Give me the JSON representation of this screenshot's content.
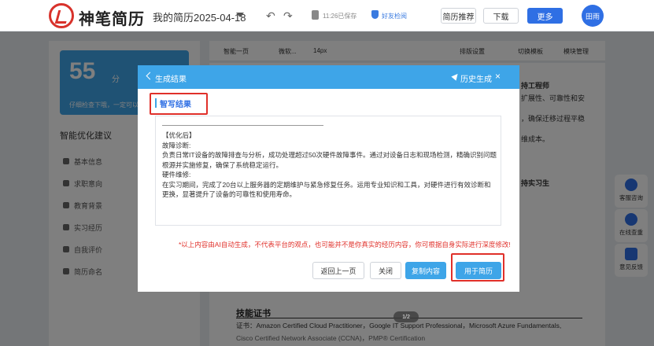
{
  "header": {
    "brand": "神笔简历",
    "doc_title": "我的简历2025-04-18",
    "save_status": "11:26已保存",
    "friend_check": "好友检阅",
    "recommend_label": "简历推荐",
    "download_label": "下载",
    "more_label": "更多",
    "avatar_label": "田雨"
  },
  "left_panel": {
    "score": "55",
    "score_unit": "分",
    "score_tip": "仔细检查下哦，一定可以",
    "suggest_title": "智能优化建议",
    "items": [
      {
        "label": "基本信息"
      },
      {
        "label": "求职意向"
      },
      {
        "label": "教育背景"
      },
      {
        "label": "实习经历"
      },
      {
        "label": "自我评价"
      },
      {
        "label": "简历命名"
      }
    ]
  },
  "toolbar": {
    "prev_page": "智能一页",
    "font": "微软...",
    "font_size": "14px",
    "layout": "排版设置",
    "switch_template": "切换模板",
    "module_manage": "模块管理"
  },
  "document": {
    "right_1": "持工程师",
    "right_2": "扩展性、可靠性和安",
    "right_3": "，确保迁移过程平稳",
    "right_4": "维成本。",
    "right_5": "持实习生",
    "section_title": "技能证书",
    "cert_line": "证书：Amazon Certified Cloud Practitioner，Google IT Support Professional，Microsoft Azure Fundamentals,",
    "cert_line2": "Cisco Certified Network Associate (CCNA)，PMP® Certification",
    "page_indicator": "1/2"
  },
  "float_panel": {
    "service": "客服咨询",
    "review": "在线查重",
    "feedback": "意见反馈"
  },
  "modal": {
    "title": "生成结果",
    "history": "历史生成",
    "close": "×",
    "tab": "智写结果",
    "result_text": "【优化后】\n故障诊断:\n负责日常IT设备的故障排查与分析，成功处理超过50次硬件故障事件。通过对设备日志和现场检测，精确识别问题根源并实施修复，确保了系统稳定运行。\n硬件维修:\n在实习期间，完成了20台以上服务器的定期维护与紧急修复任务。运用专业知识和工具，对硬件进行有效诊断和更换，显著提升了设备的可靠性和使用寿命。",
    "disclaimer": "*以上内容由AI自动生成，不代表平台的观点，也可能并不是你真实的经历内容，你可根据自身实际进行深度修改!",
    "back_label": "返回上一页",
    "close_label": "关闭",
    "copy_label": "复制内容",
    "apply_label": "用于简历"
  },
  "colors": {
    "accent": "#3ea5e8",
    "primary": "#2f6fe4",
    "highlight": "#e0302a"
  }
}
